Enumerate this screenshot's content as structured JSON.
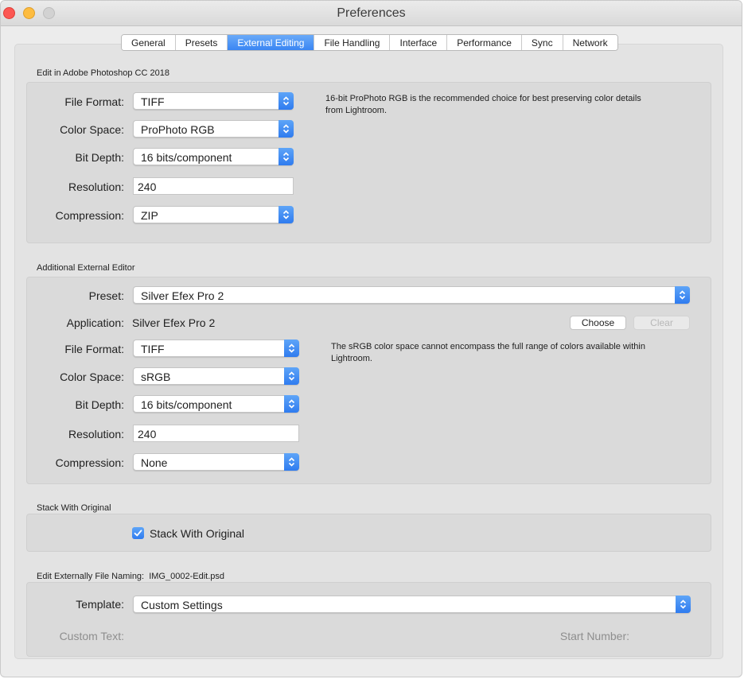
{
  "window": {
    "title": "Preferences"
  },
  "tabs": [
    "General",
    "Presets",
    "External Editing",
    "File Handling",
    "Interface",
    "Performance",
    "Sync",
    "Network"
  ],
  "active_tab": "External Editing",
  "photoshop": {
    "section_title": "Edit in Adobe Photoshop CC 2018",
    "file_format_label": "File Format:",
    "file_format": "TIFF",
    "color_space_label": "Color Space:",
    "color_space": "ProPhoto RGB",
    "bit_depth_label": "Bit Depth:",
    "bit_depth": "16 bits/component",
    "resolution_label": "Resolution:",
    "resolution": "240",
    "compression_label": "Compression:",
    "compression": "ZIP",
    "hint": "16-bit ProPhoto RGB is the recommended choice for best preserving color details from Lightroom."
  },
  "external": {
    "section_title": "Additional External Editor",
    "preset_label": "Preset:",
    "preset": "Silver Efex Pro 2",
    "application_label": "Application:",
    "application": "Silver Efex Pro 2",
    "choose_label": "Choose",
    "clear_label": "Clear",
    "file_format_label": "File Format:",
    "file_format": "TIFF",
    "color_space_label": "Color Space:",
    "color_space": "sRGB",
    "bit_depth_label": "Bit Depth:",
    "bit_depth": "16 bits/component",
    "resolution_label": "Resolution:",
    "resolution": "240",
    "compression_label": "Compression:",
    "compression": "None",
    "hint": "The sRGB color space cannot encompass the full range of colors available within Lightroom."
  },
  "stack": {
    "section_title": "Stack With Original",
    "checkbox_label": "Stack With Original",
    "checked": true
  },
  "naming": {
    "section_title": "Edit Externally File Naming:  IMG_0002-Edit.psd",
    "template_label": "Template:",
    "template": "Custom Settings",
    "custom_text_label": "Custom Text:",
    "start_number_label": "Start Number:"
  },
  "colors": {
    "accent": "#3a86f3",
    "close": "#fc5753",
    "minimize": "#fdbc40",
    "maximize": "#d2d2d2"
  },
  "icons": {
    "popup": "chevron-updown-icon",
    "check": "checkmark-icon"
  }
}
